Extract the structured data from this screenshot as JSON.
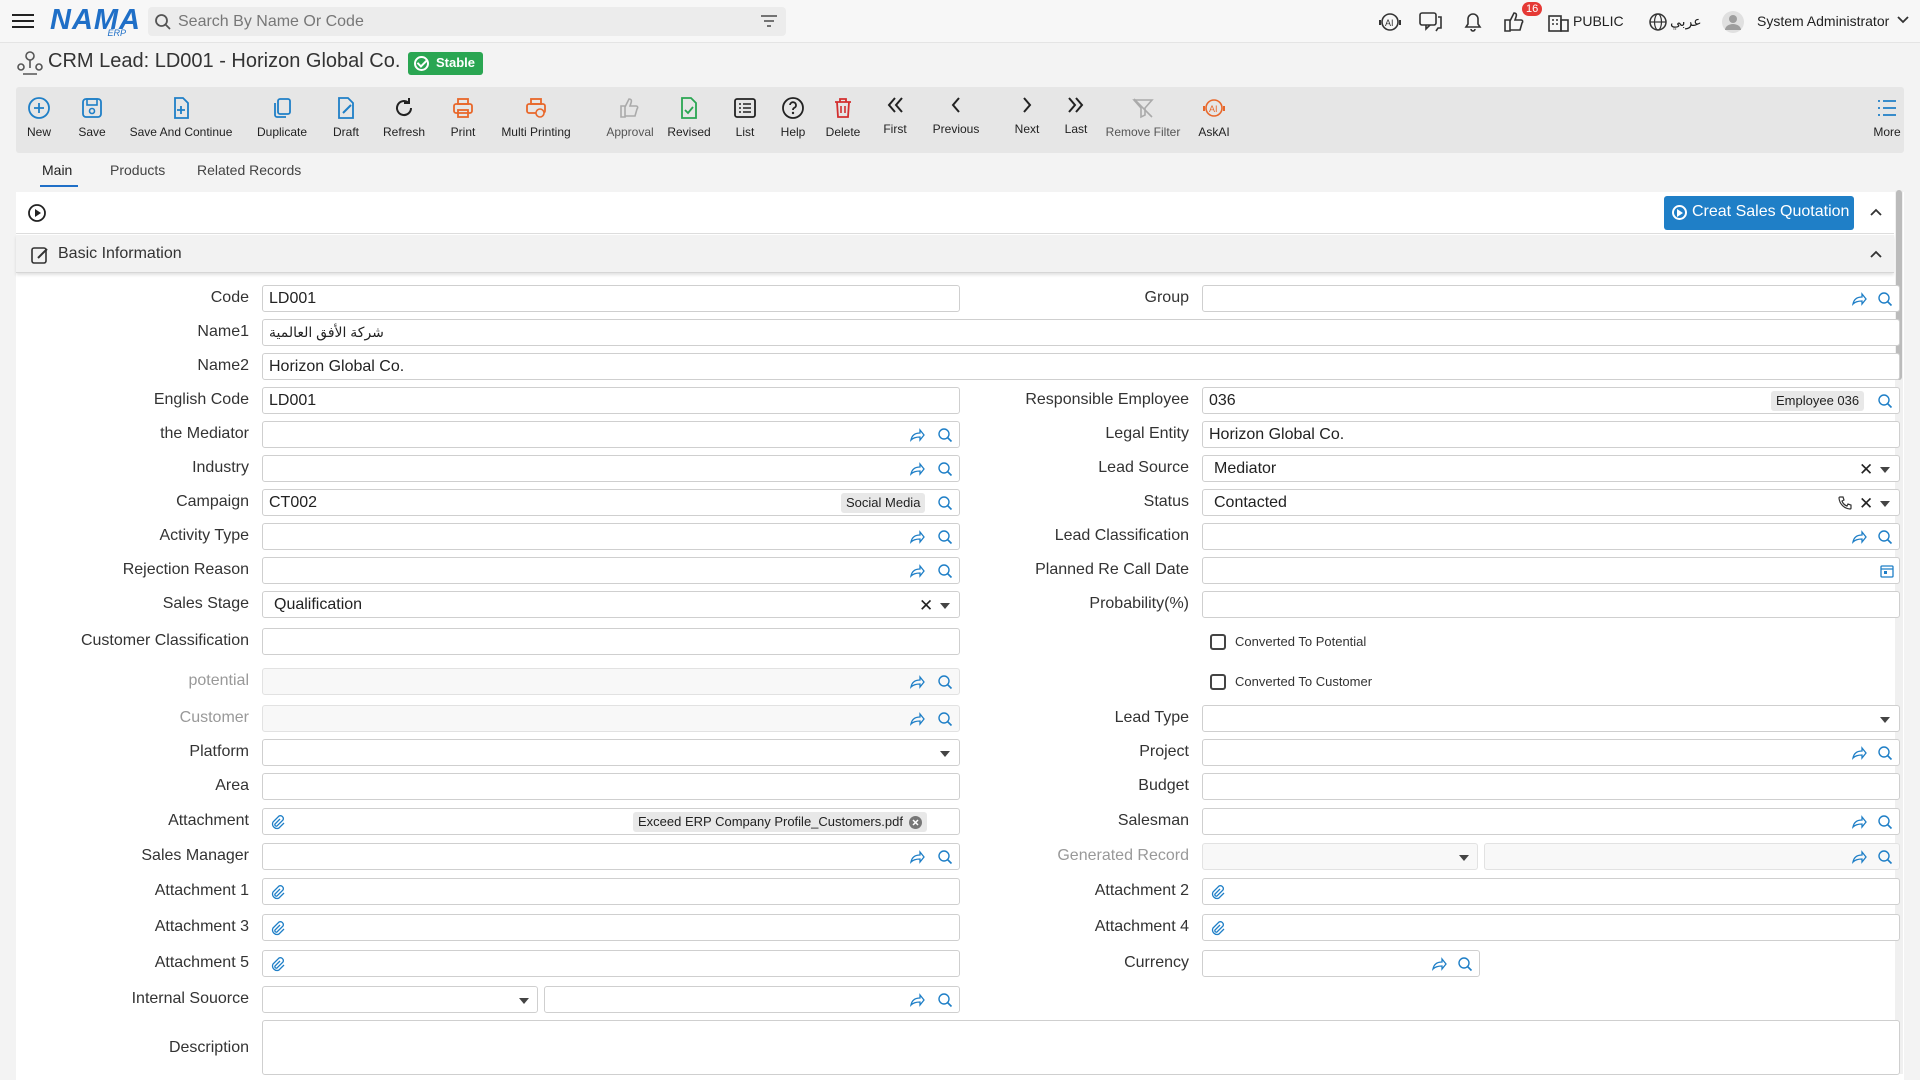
{
  "topbar": {
    "logo": "NAMA",
    "logo_sub": "ERP",
    "search_placeholder": "Search By Name Or Code",
    "notification_count": "16",
    "company": "PUBLIC",
    "language": "عربي",
    "user": "System Administrator"
  },
  "page": {
    "title": "CRM Lead: LD001 - Horizon Global Co.",
    "status_badge": "Stable"
  },
  "toolbar": {
    "new": "New",
    "save": "Save",
    "save_continue": "Save And Continue",
    "duplicate": "Duplicate",
    "draft": "Draft",
    "refresh": "Refresh",
    "print": "Print",
    "multi_printing": "Multi Printing",
    "approval": "Approval",
    "revised": "Revised",
    "list": "List",
    "help": "Help",
    "delete": "Delete",
    "first": "First",
    "previous": "Previous",
    "next": "Next",
    "last": "Last",
    "remove_filter": "Remove Filter",
    "askai": "AskAI",
    "more": "More"
  },
  "tabs": {
    "main": "Main",
    "products": "Products",
    "related": "Related Records"
  },
  "actions": {
    "create_quotation": "Creat Sales Quotation"
  },
  "section": {
    "title": "Basic Information"
  },
  "labels": {
    "code": "Code",
    "group": "Group",
    "name1": "Name1",
    "name2": "Name2",
    "english_code": "English Code",
    "responsible_employee": "Responsible Employee",
    "mediator": "the Mediator",
    "legal_entity": "Legal Entity",
    "industry": "Industry",
    "lead_source": "Lead Source",
    "campaign": "Campaign",
    "status": "Status",
    "activity_type": "Activity Type",
    "lead_classification": "Lead Classification",
    "rejection_reason": "Rejection Reason",
    "planned_recall": "Planned Re Call Date",
    "sales_stage": "Sales Stage",
    "probability": "Probability(%)",
    "customer_classification": "Customer Classification",
    "converted_potential": "Converted To Potential",
    "potential": "potential",
    "converted_customer": "Converted To Customer",
    "customer": "Customer",
    "lead_type": "Lead Type",
    "platform": "Platform",
    "project": "Project",
    "area": "Area",
    "budget": "Budget",
    "attachment": "Attachment",
    "salesman": "Salesman",
    "sales_manager": "Sales Manager",
    "generated_record": "Generated Record",
    "attachment1": "Attachment 1",
    "attachment2": "Attachment 2",
    "attachment3": "Attachment 3",
    "attachment4": "Attachment 4",
    "attachment5": "Attachment 5",
    "currency": "Currency",
    "internal_source": "Internal Souorce",
    "description": "Description"
  },
  "values": {
    "code": "LD001",
    "name1": "شركة الأفق العالمية",
    "name2": "Horizon Global Co.",
    "english_code": "LD001",
    "responsible_employee": "036",
    "responsible_employee_chip": "Employee 036",
    "legal_entity": "Horizon Global Co.",
    "lead_source": "Mediator",
    "campaign": "CT002",
    "campaign_chip": "Social Media",
    "status": "Contacted",
    "sales_stage": "Qualification",
    "attachment_file": "Exceed ERP Company Profile_Customers.pdf"
  }
}
